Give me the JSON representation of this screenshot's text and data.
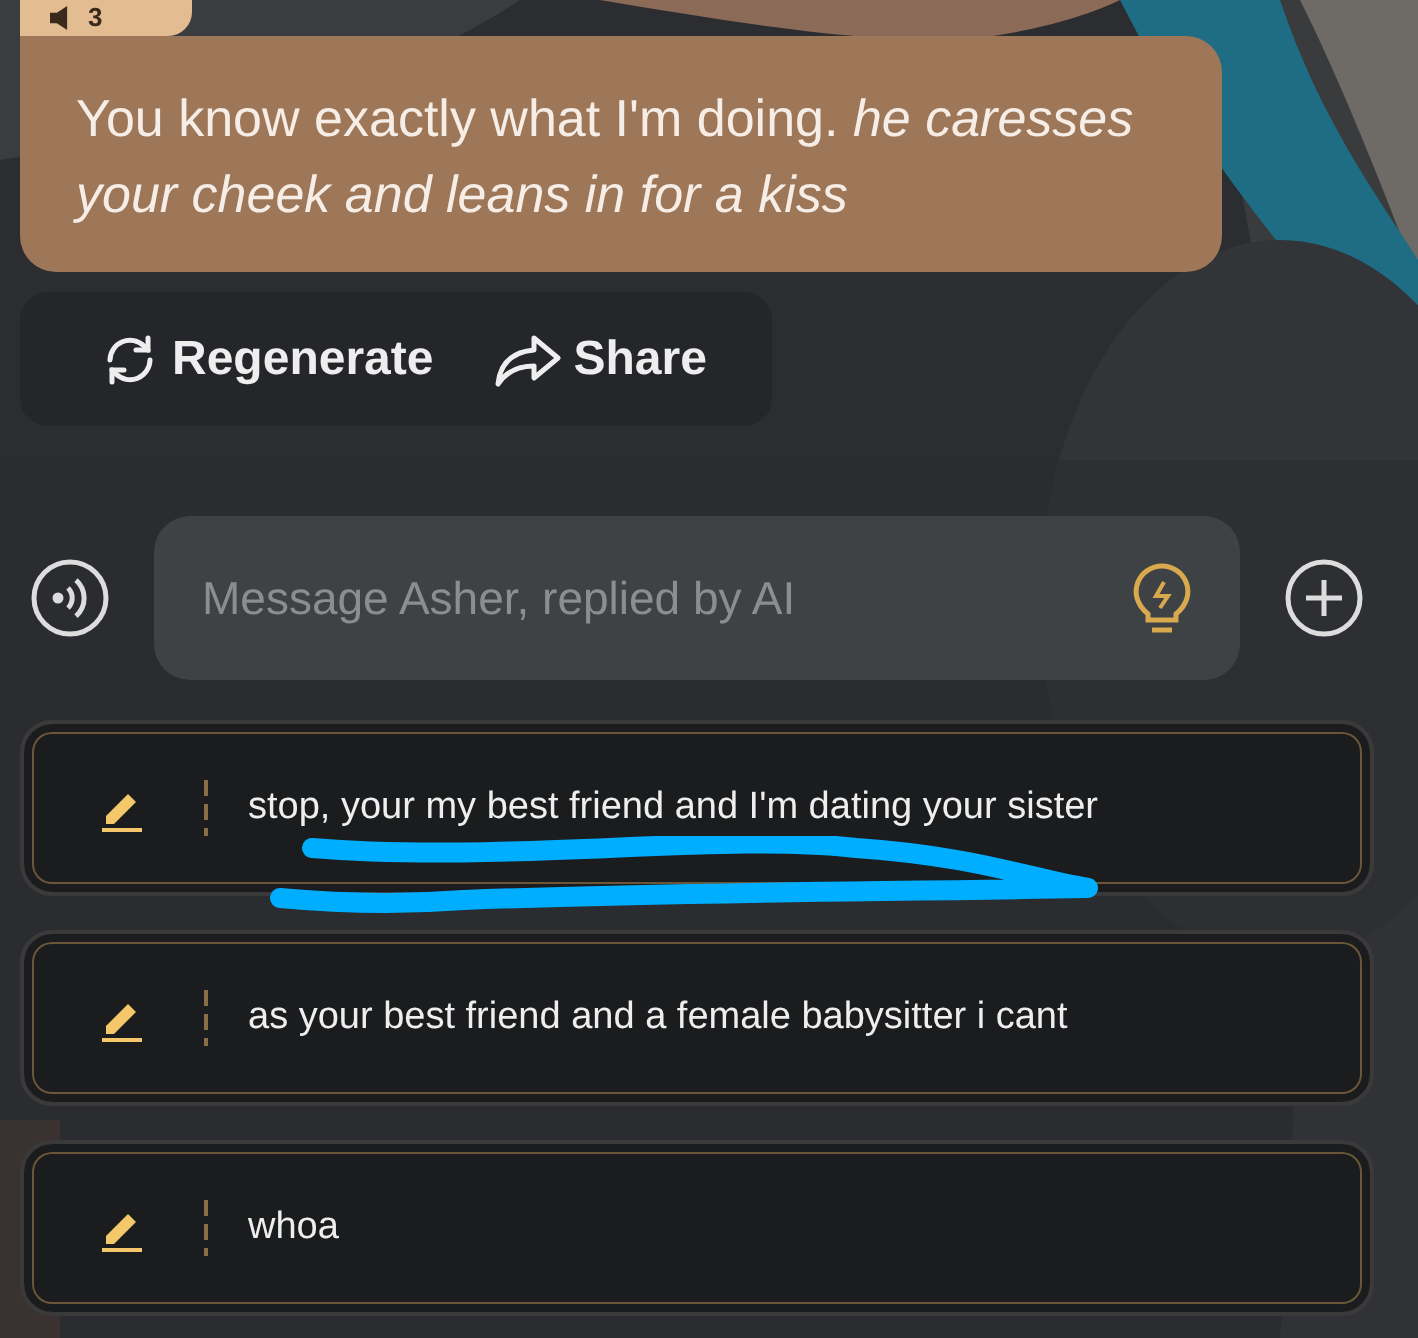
{
  "message": {
    "badge": "3",
    "text": "You know exactly what I'm doing. *he caresses your cheek and leans in for a kiss*"
  },
  "actions": [
    {
      "kind": "regenerate",
      "label": "Regenerate"
    },
    {
      "kind": "share",
      "label": "Share"
    }
  ],
  "composer": {
    "placeholder": "Message Asher, replied by AI"
  },
  "suggestions": [
    {
      "text": "stop, your my best friend and I'm dating your sister",
      "annotated": true
    },
    {
      "text": "as your best friend and a female babysitter i cant",
      "annotated": false
    },
    {
      "text": "whoa",
      "annotated": false
    }
  ]
}
